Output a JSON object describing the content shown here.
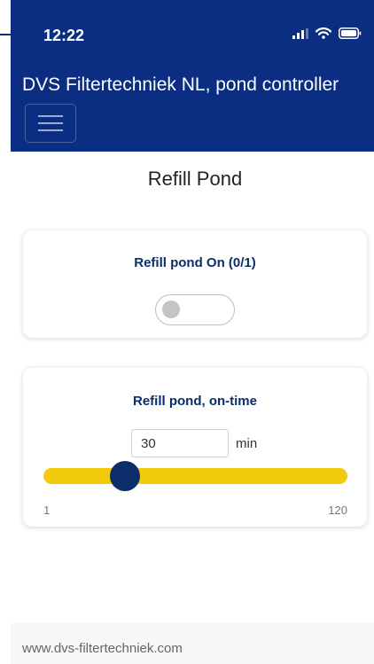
{
  "status_bar": {
    "time": "12:22",
    "icons": [
      "signal-icon",
      "wifi-icon",
      "battery-icon"
    ]
  },
  "header": {
    "title": "DVS Filtertechniek NL, pond controller",
    "menu_icon": "hamburger-menu-icon"
  },
  "page": {
    "title": "Refill Pond"
  },
  "refill_toggle": {
    "label": "Refill pond On (0/1)",
    "state": "off"
  },
  "ontime": {
    "label": "Refill pond, on-time",
    "value": "30",
    "unit": "min",
    "min": "1",
    "max": "120",
    "slider_value": 30
  },
  "footer": {
    "text": "www.dvs-filtertechniek.com"
  },
  "colors": {
    "header_bg": "#0b2d82",
    "accent_dark": "#0b2d6a",
    "slider_track": "#f2cb0c",
    "footer_bg": "#f6f7f9"
  }
}
